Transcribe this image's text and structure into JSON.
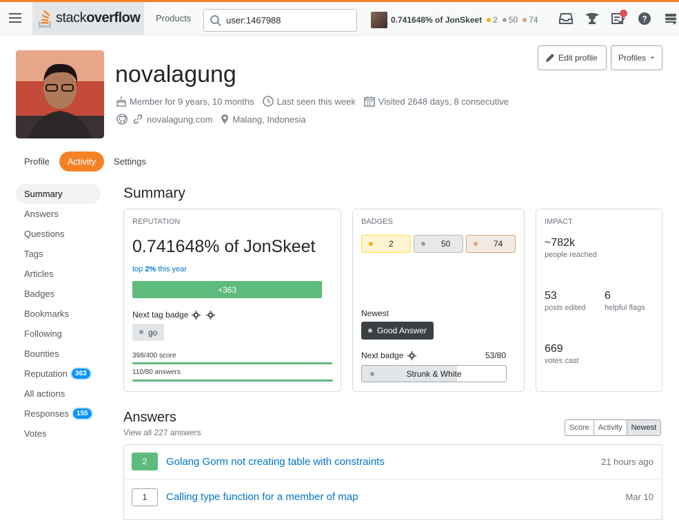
{
  "topbar": {
    "logo_prefix": "stack",
    "logo_bold": "overflow",
    "products": "Products",
    "search_value": "user:1467988",
    "rep": "0.741648% of JonSkeet",
    "gold": "2",
    "silver": "50",
    "bronze": "74"
  },
  "profile": {
    "name": "novalagung",
    "member": "Member for 9 years, 10 months",
    "last_seen": "Last seen this week",
    "visited": "Visited 2648 days, 8 consecutive",
    "website": "novalagung.com",
    "location": "Malang, Indonesia",
    "edit": "Edit profile",
    "profiles": "Profiles"
  },
  "tabs": [
    "Profile",
    "Activity",
    "Settings"
  ],
  "sidenav": {
    "summary": "Summary",
    "answers": "Answers",
    "questions": "Questions",
    "tags": "Tags",
    "articles": "Articles",
    "badges": "Badges",
    "bookmarks": "Bookmarks",
    "following": "Following",
    "bounties": "Bounties",
    "reputation": "Reputation",
    "reputation_count": "363",
    "all_actions": "All actions",
    "responses": "Responses",
    "responses_count": "155",
    "votes": "Votes"
  },
  "summary": {
    "title": "Summary",
    "reputation": {
      "cap": "Reputation",
      "value": "0.741648% of JonSkeet",
      "top_pre": "top ",
      "top_pct": "2%",
      "top_post": " this year",
      "gain": "+363",
      "next_tag": "Next tag badge",
      "tag": "go",
      "score": "398/400 score",
      "score_progress": 0.995,
      "answers": "110/80 answers",
      "answers_progress": 1.0
    },
    "badges": {
      "cap": "Badges",
      "gold": "2",
      "silver": "50",
      "bronze": "74",
      "newest": "Newest",
      "newest_badge": "Good Answer",
      "next": "Next badge",
      "next_progress": "53/80",
      "next_badge": "Strunk & White",
      "next_fill": 0.6625
    },
    "impact": {
      "cap": "Impact",
      "reached": "~782k",
      "reached_label": "people reached",
      "edited": "53",
      "edited_label": "posts edited",
      "flags": "6",
      "flags_label": "helpful flags",
      "votes": "669",
      "votes_label": "votes cast"
    }
  },
  "answers": {
    "title": "Answers",
    "view_all": "View all 227 answers",
    "sort": [
      "Score",
      "Activity",
      "Newest"
    ],
    "items": [
      {
        "score": "2",
        "title": "Golang Gorm not creating table with constraints",
        "date": "21 hours ago"
      },
      {
        "score": "1",
        "title": "Calling type function for a member of map",
        "date": "Mar 10"
      }
    ]
  },
  "colors": {
    "accent": "#f48225",
    "link": "#0074cc",
    "success": "#5eba7d"
  }
}
